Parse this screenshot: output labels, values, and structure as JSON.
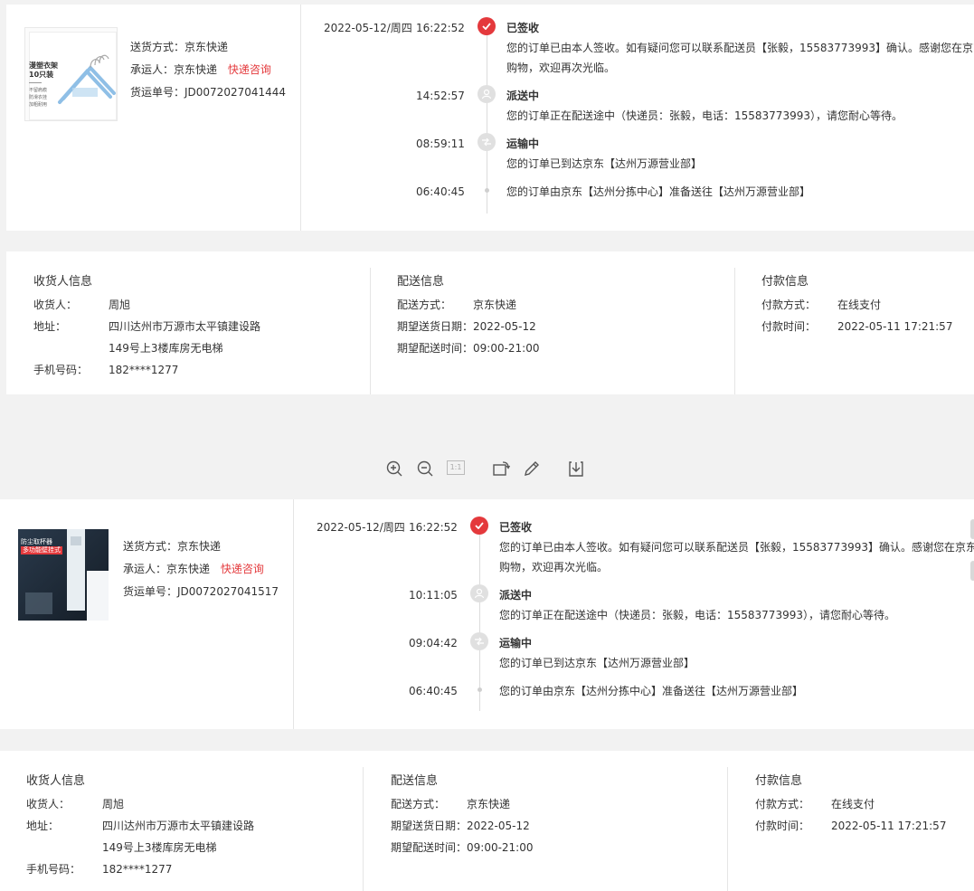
{
  "orders": [
    {
      "ship_method": "送货方式：京东快递",
      "carrier_prefix": "承运人：京东快递",
      "carrier_link": "快递咨询",
      "waybill": "货运单号：JD0072027041444",
      "product_image_text": {
        "line1": "漫塑衣架",
        "line2": "10只装",
        "small1": "不留肩痕",
        "small2": "防滑衣挂",
        "small3": "加粗耐用"
      },
      "date": "2022-05-12/周四",
      "events": [
        {
          "time": "16:22:52",
          "title": "已签收",
          "line1": "您的订单已由本人签收。如有疑问您可以联系配送员【张毅，15583773993】确认。感谢您在京东",
          "line2": "购物，欢迎再次光临。"
        },
        {
          "time": "14:52:57",
          "title": "派送中",
          "line1": "您的订单正在配送途中（快递员：张毅，电话：15583773993），请您耐心等待。"
        },
        {
          "time": "08:59:11",
          "title": "运输中",
          "line1": "您的订单已到达京东【达州万源营业部】"
        },
        {
          "time": "06:40:45",
          "line1": "您的订单由京东【达州分拣中心】准备送往【达州万源营业部】"
        }
      ],
      "receiver": {
        "title": "收货人信息",
        "name_label": "收货人：",
        "name": "周旭",
        "addr_label": "地址：",
        "addr1": "四川达州市万源市太平镇建设路",
        "addr2": "149号上3楼库房无电梯",
        "phone_label": "手机号码：",
        "phone": "182****1277"
      },
      "delivery": {
        "title": "配送信息",
        "method_label": "配送方式：",
        "method": "京东快递",
        "date_label": "期望送货日期：",
        "date": "2022-05-12",
        "time_label": "期望配送时间：",
        "time": "09:00-21:00"
      },
      "payment": {
        "title": "付款信息",
        "method_label": "付款方式：",
        "method": "在线支付",
        "time_label": "付款时间：",
        "time": "2022-05-11 17:21:57"
      }
    },
    {
      "ship_method": "送货方式：京东快递",
      "carrier_prefix": "承运人：京东快递",
      "carrier_link": "快递咨询",
      "waybill": "货运单号：JD0072027041517",
      "product_image_text": {
        "line1": "防尘取杯器",
        "line2": "多功能壁挂式"
      },
      "date": "2022-05-12/周四",
      "events": [
        {
          "time": "16:22:52",
          "title": "已签收",
          "line1": "您的订单已由本人签收。如有疑问您可以联系配送员【张毅，15583773993】确认。感谢您在京东",
          "line2": "购物，欢迎再次光临。"
        },
        {
          "time": "10:11:05",
          "title": "派送中",
          "line1": "您的订单正在配送途中（快递员：张毅，电话：15583773993），请您耐心等待。"
        },
        {
          "time": "09:04:42",
          "title": "运输中",
          "line1": "您的订单已到达京东【达州万源营业部】"
        },
        {
          "time": "06:40:45",
          "line1": "您的订单由京东【达州分拣中心】准备送往【达州万源营业部】"
        }
      ],
      "receiver": {
        "title": "收货人信息",
        "name_label": "收货人：",
        "name": "周旭",
        "addr_label": "地址：",
        "addr1": "四川达州市万源市太平镇建设路",
        "addr2": "149号上3楼库房无电梯",
        "phone_label": "手机号码：",
        "phone": "182****1277"
      },
      "delivery": {
        "title": "配送信息",
        "method_label": "配送方式：",
        "method": "京东快递",
        "date_label": "期望送货日期：",
        "date": "2022-05-12",
        "time_label": "期望配送时间：",
        "time": "09:00-21:00"
      },
      "payment": {
        "title": "付款信息",
        "method_label": "付款方式：",
        "method": "在线支付",
        "time_label": "付款时间：",
        "time": "2022-05-11 17:21:57"
      }
    }
  ],
  "toolbar": {
    "zoom_in": "zoom-in-icon",
    "zoom_out": "zoom-out-icon",
    "actual_size": "1:1",
    "rotate": "rotate-icon",
    "edit": "pencil-icon",
    "download": "download-icon"
  },
  "colors": {
    "accent": "#e4393c",
    "panel": "#ffffff",
    "background": "#f2f2f2"
  }
}
